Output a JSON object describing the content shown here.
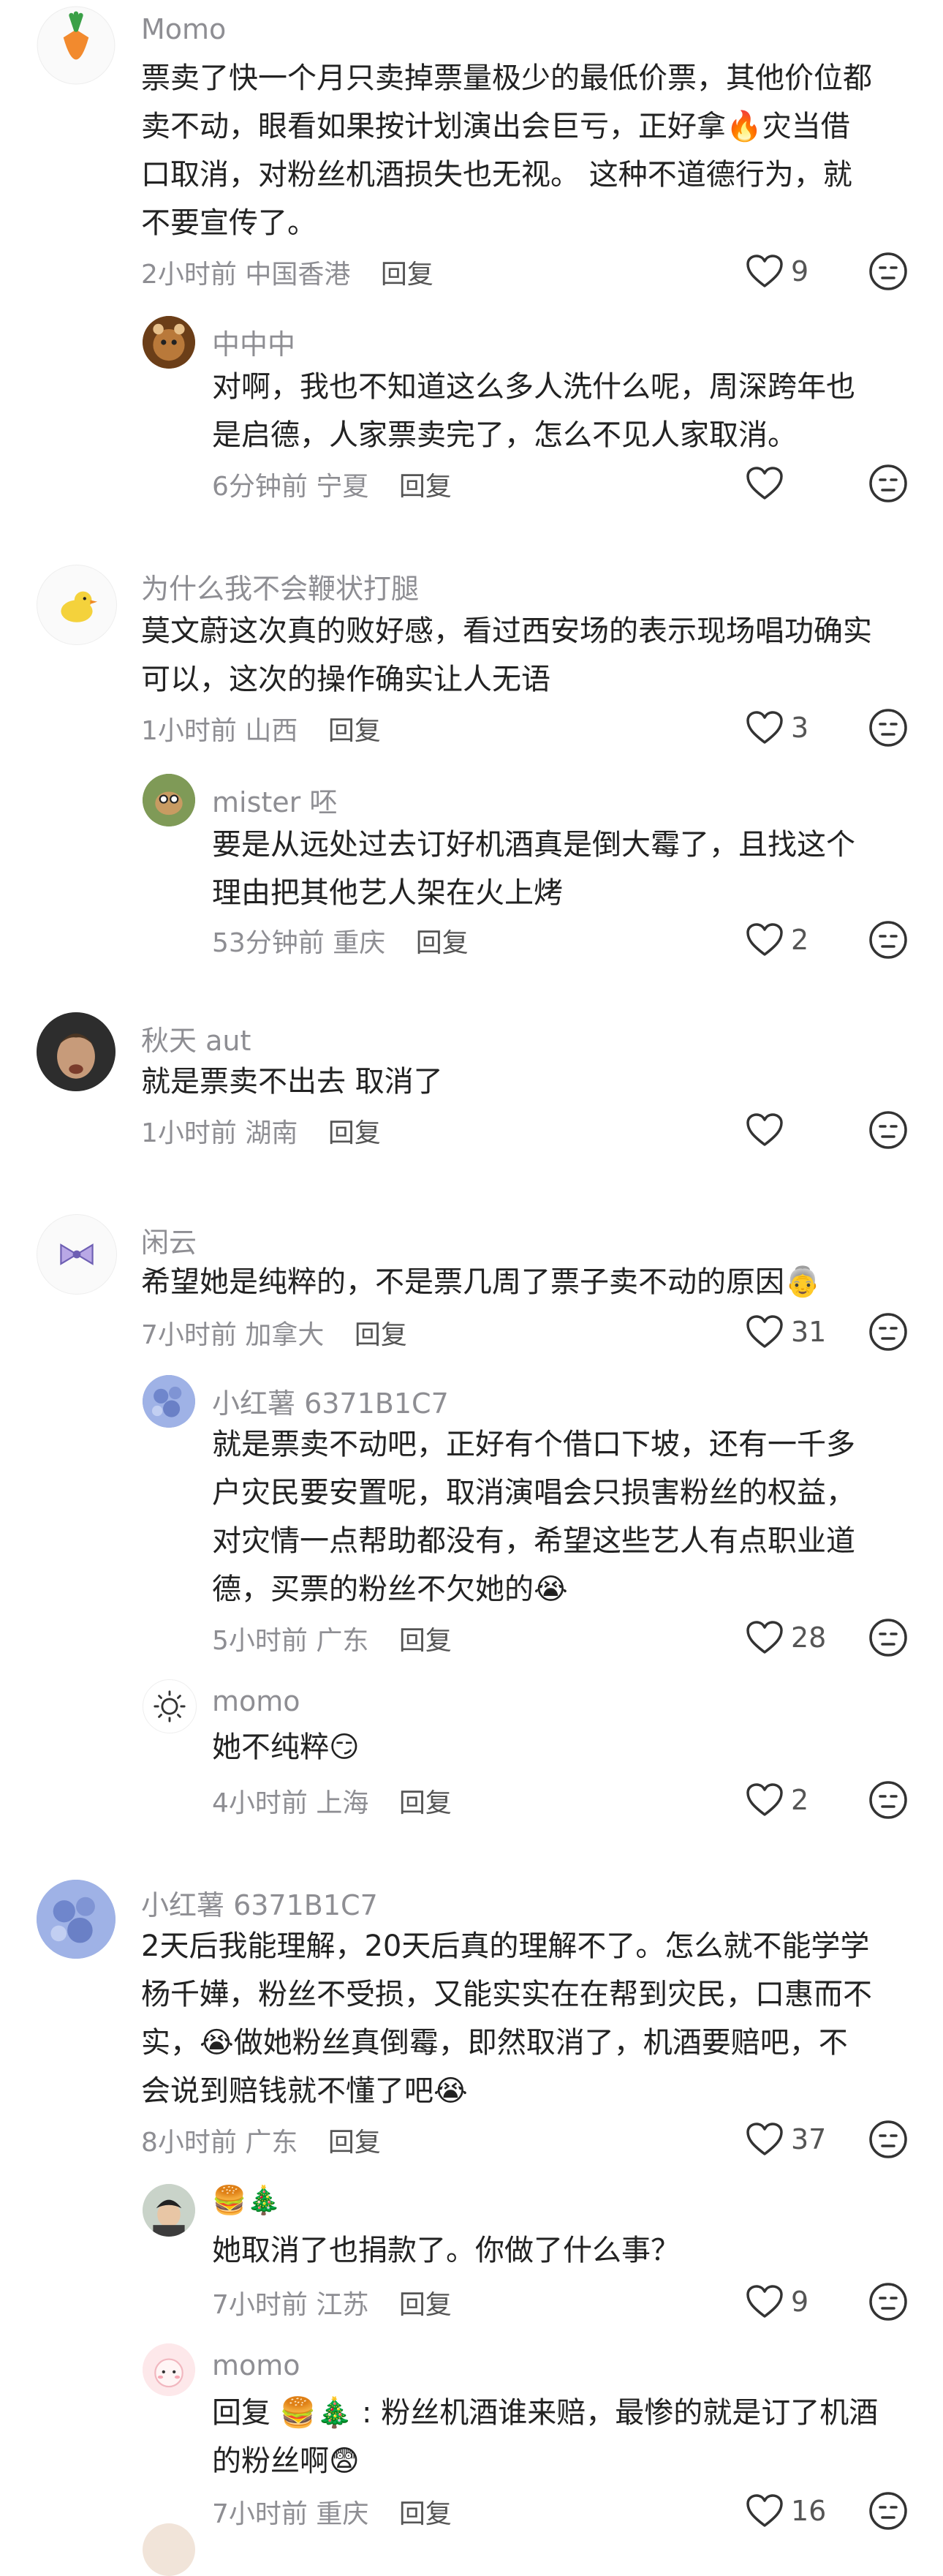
{
  "comments": [
    {
      "user": "Momo",
      "lines": [
        "票卖了快一个月只卖掉票量极少的最低价票，其他价位都",
        "卖不动，眼看如果按计划演出会巨亏，正好拿🔥灾当借",
        "口取消，对粉丝机酒损失也无视。 这种不道德行为，就",
        "不要宣传了。"
      ],
      "time": "2小时前",
      "location": "中国香港",
      "reply_label": "回复",
      "likes": "9"
    },
    {
      "user": "中中中",
      "lines": [
        "对啊，我也不知道这么多人洗什么呢，周深跨年也",
        "是启德，人家票卖完了，怎么不见人家取消。"
      ],
      "time": "6分钟前",
      "location": "宁夏",
      "reply_label": "回复",
      "likes": ""
    },
    {
      "user": "为什么我不会鞭状打腿",
      "lines": [
        "莫文蔚这次真的败好感，看过西安场的表示现场唱功确实",
        "可以，这次的操作确实让人无语"
      ],
      "time": "1小时前",
      "location": "山西",
      "reply_label": "回复",
      "likes": "3"
    },
    {
      "user": "mister 呸",
      "lines": [
        "要是从远处过去订好机酒真是倒大霉了，且找这个",
        "理由把其他艺人架在火上烤"
      ],
      "time": "53分钟前",
      "location": "重庆",
      "reply_label": "回复",
      "likes": "2"
    },
    {
      "user": "秋天 aut",
      "lines": [
        "就是票卖不出去 取消了"
      ],
      "time": "1小时前",
      "location": "湖南",
      "reply_label": "回复",
      "likes": ""
    },
    {
      "user": "闲云",
      "lines": [
        "希望她是纯粹的，不是票几周了票子卖不动的原因👵"
      ],
      "time": "7小时前",
      "location": "加拿大",
      "reply_label": "回复",
      "likes": "31"
    },
    {
      "user": "小红薯 6371B1C7",
      "lines": [
        "就是票卖不动吧，正好有个借口下坡，还有一千多",
        "户灾民要安置呢，取消演唱会只损害粉丝的权益，",
        "对灾情一点帮助都没有，希望这些艺人有点职业道",
        "德，买票的粉丝不欠她的😭"
      ],
      "time": "5小时前",
      "location": "广东",
      "reply_label": "回复",
      "likes": "28"
    },
    {
      "user": "momo",
      "lines": [
        "她不纯粹😏"
      ],
      "time": "4小时前",
      "location": "上海",
      "reply_label": "回复",
      "likes": "2"
    },
    {
      "user": "小红薯 6371B1C7",
      "lines": [
        "2天后我能理解，20天后真的理解不了。怎么就不能学学",
        "杨千嬅，粉丝不受损，又能实实在在帮到灾民，口惠而不",
        "实，😭做她粉丝真倒霉，即然取消了，机酒要赔吧，不",
        "会说到赔钱就不懂了吧😭"
      ],
      "time": "8小时前",
      "location": "广东",
      "reply_label": "回复",
      "likes": "37"
    },
    {
      "user": "🍔🎄",
      "lines": [
        "她取消了也捐款了。你做了什么事？"
      ],
      "time": "7小时前",
      "location": "江苏",
      "reply_label": "回复",
      "likes": "9"
    },
    {
      "user": "momo",
      "lines": [
        "回复 🍔🎄 : 粉丝机酒谁来赔，最惨的就是订了机酒",
        "的粉丝啊😨"
      ],
      "time": "7小时前",
      "location": "重庆",
      "reply_label": "回复",
      "likes": "16"
    }
  ],
  "colors": {
    "meta": "#8e8e93",
    "text": "#222222",
    "heart_stroke": "#333333"
  },
  "icons": {
    "like": "heart-outline-icon",
    "dislike": "neutral-face-icon"
  }
}
